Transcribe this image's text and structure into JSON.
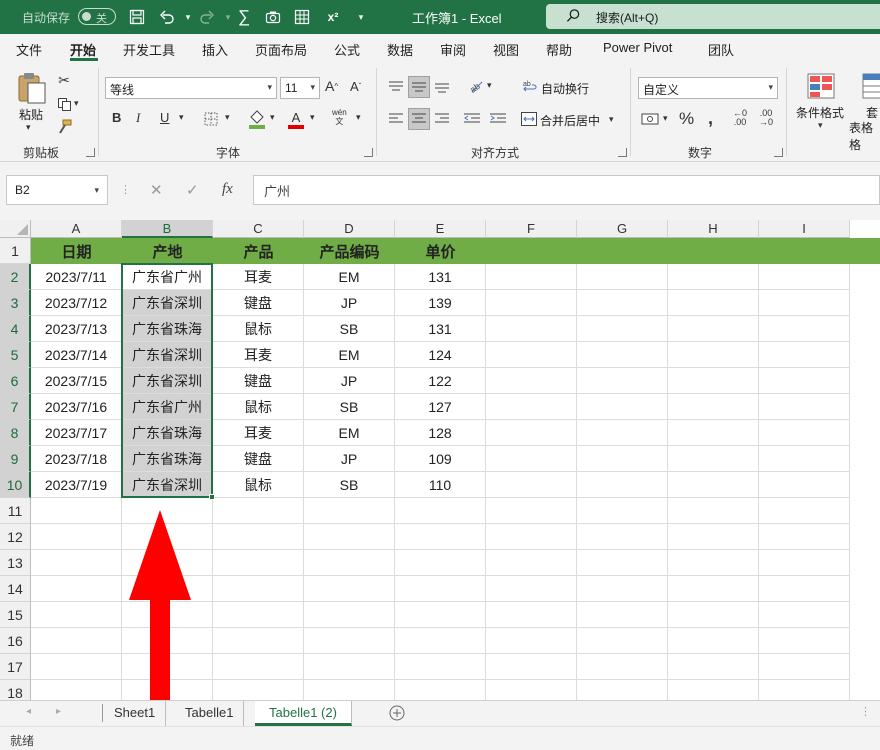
{
  "titlebar": {
    "autosave_label": "自动保存",
    "autosave_state": "关",
    "title": "工作簿1  -  Excel",
    "search_placeholder": "搜索(Alt+Q)"
  },
  "menu": [
    "文件",
    "开始",
    "开发工具",
    "插入",
    "页面布局",
    "公式",
    "数据",
    "审阅",
    "视图",
    "帮助",
    "Power Pivot",
    "团队"
  ],
  "ribbon": {
    "paste_label": "粘贴",
    "clipboard_group": "剪贴板",
    "font_name": "等线",
    "font_size": "11",
    "font_group": "字体",
    "bold": "B",
    "italic": "I",
    "underline": "U",
    "wrap_text": "自动换行",
    "merge_center": "合并后居中",
    "align_group": "对齐方式",
    "number_format": "自定义",
    "number_group": "数字",
    "conditional_format": "条件格式",
    "table_format_1": "套",
    "table_format_2": "表格格"
  },
  "formula_bar": {
    "name_box": "B2",
    "formula": "广州",
    "fx": "fx"
  },
  "columns": [
    "A",
    "B",
    "C",
    "D",
    "E",
    "F",
    "G",
    "H",
    "I"
  ],
  "rows": [
    "1",
    "2",
    "3",
    "4",
    "5",
    "6",
    "7",
    "8",
    "9",
    "10",
    "11",
    "12",
    "13",
    "14",
    "15",
    "16",
    "17",
    "18"
  ],
  "table": {
    "headers": [
      "日期",
      "产地",
      "产品",
      "产品编码",
      "单价"
    ],
    "data": [
      [
        "2023/7/11",
        "广东省广州",
        "耳麦",
        "EM",
        "131"
      ],
      [
        "2023/7/12",
        "广东省深圳",
        "键盘",
        "JP",
        "139"
      ],
      [
        "2023/7/13",
        "广东省珠海",
        "鼠标",
        "SB",
        "131"
      ],
      [
        "2023/7/14",
        "广东省深圳",
        "耳麦",
        "EM",
        "124"
      ],
      [
        "2023/7/15",
        "广东省深圳",
        "键盘",
        "JP",
        "122"
      ],
      [
        "2023/7/16",
        "广东省广州",
        "鼠标",
        "SB",
        "127"
      ],
      [
        "2023/7/17",
        "广东省珠海",
        "耳麦",
        "EM",
        "128"
      ],
      [
        "2023/7/18",
        "广东省珠海",
        "键盘",
        "JP",
        "109"
      ],
      [
        "2023/7/19",
        "广东省深圳",
        "鼠标",
        "SB",
        "110"
      ]
    ]
  },
  "sheets": [
    "Sheet1",
    "Tabelle1",
    "Tabelle1 (2)"
  ],
  "active_sheet": "Tabelle1 (2)",
  "status": "就绪",
  "colors": {
    "accent": "#217346",
    "header_fill": "#70ad47",
    "arrow": "#ff0000"
  }
}
